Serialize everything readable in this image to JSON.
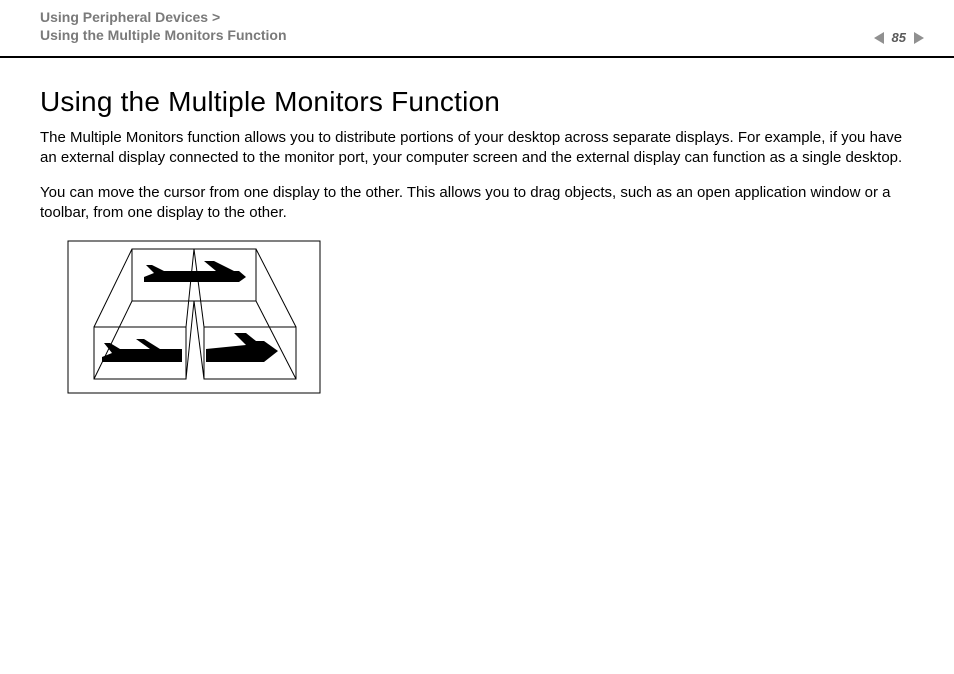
{
  "header": {
    "breadcrumb_line1": "Using Peripheral Devices >",
    "breadcrumb_line2": "Using the Multiple Monitors Function",
    "page_number": "85"
  },
  "content": {
    "title": "Using the Multiple Monitors Function",
    "paragraph1": "The Multiple Monitors function allows you to distribute portions of your desktop across separate displays. For example, if you have an external display connected to the monitor port, your computer screen and the external display can function as a single desktop.",
    "paragraph2": "You can move the cursor from one display to the other. This allows you to drag objects, such as an open application window or a toolbar, from one display to the other."
  }
}
